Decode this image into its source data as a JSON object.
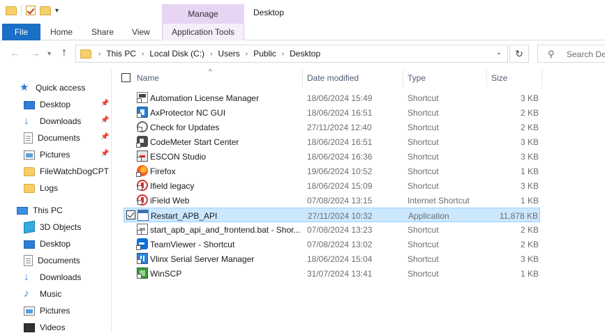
{
  "titlebar": {
    "manage_label": "Manage",
    "window_title": "Desktop"
  },
  "ribbon": {
    "file": "File",
    "home": "Home",
    "share": "Share",
    "view": "View",
    "application_tools": "Application Tools"
  },
  "address": {
    "crumbs": [
      "This PC",
      "Local Disk (C:)",
      "Users",
      "Public",
      "Desktop"
    ],
    "search_placeholder": "Search Des"
  },
  "sidebar": {
    "quick_access": {
      "label": "Quick access",
      "items": [
        {
          "label": "Desktop",
          "icon": "desktop-icon",
          "pinned": true
        },
        {
          "label": "Downloads",
          "icon": "download-icon",
          "pinned": true
        },
        {
          "label": "Documents",
          "icon": "document-icon",
          "pinned": true
        },
        {
          "label": "Pictures",
          "icon": "pictures-icon",
          "pinned": true
        },
        {
          "label": "FileWatchDogCPT",
          "icon": "folder-icon",
          "pinned": false
        },
        {
          "label": "Logs",
          "icon": "folder-icon",
          "pinned": false
        }
      ]
    },
    "this_pc": {
      "label": "This PC",
      "items": [
        {
          "label": "3D Objects",
          "icon": "3d-objects-icon"
        },
        {
          "label": "Desktop",
          "icon": "desktop-icon"
        },
        {
          "label": "Documents",
          "icon": "document-icon"
        },
        {
          "label": "Downloads",
          "icon": "download-icon"
        },
        {
          "label": "Music",
          "icon": "music-icon"
        },
        {
          "label": "Pictures",
          "icon": "pictures-icon"
        },
        {
          "label": "Videos",
          "icon": "videos-icon"
        }
      ]
    }
  },
  "columns": {
    "name": "Name",
    "date": "Date modified",
    "type": "Type",
    "size": "Size"
  },
  "files": [
    {
      "name": "Automation License Manager",
      "date": "18/06/2024 15:49",
      "type": "Shortcut",
      "size": "3 KB",
      "icon": "license-manager-icon"
    },
    {
      "name": "AxProtector NC GUI",
      "date": "18/06/2024 16:51",
      "type": "Shortcut",
      "size": "2 KB",
      "icon": "axprotector-icon"
    },
    {
      "name": "Check for Updates",
      "date": "27/11/2024 12:40",
      "type": "Shortcut",
      "size": "2 KB",
      "icon": "update-icon"
    },
    {
      "name": "CodeMeter Start Center",
      "date": "18/06/2024 16:51",
      "type": "Shortcut",
      "size": "3 KB",
      "icon": "codemeter-icon"
    },
    {
      "name": "ESCON Studio",
      "date": "18/06/2024 16:36",
      "type": "Shortcut",
      "size": "3 KB",
      "icon": "escon-icon"
    },
    {
      "name": "Firefox",
      "date": "19/06/2024 10:52",
      "type": "Shortcut",
      "size": "1 KB",
      "icon": "firefox-icon"
    },
    {
      "name": "Ifield legacy",
      "date": "18/06/2024 15:09",
      "type": "Shortcut",
      "size": "3 KB",
      "icon": "ifield-icon"
    },
    {
      "name": "iField Web",
      "date": "07/08/2024 13:15",
      "type": "Internet Shortcut",
      "size": "1 KB",
      "icon": "ifield-icon"
    },
    {
      "name": "Restart_APB_API",
      "date": "27/11/2024 10:32",
      "type": "Application",
      "size": "11,878 KB",
      "icon": "application-icon",
      "selected": true
    },
    {
      "name": "start_apb_api_and_frontend.bat - Shor...",
      "date": "07/08/2024 13:23",
      "type": "Shortcut",
      "size": "2 KB",
      "icon": "batch-file-icon"
    },
    {
      "name": "TeamViewer - Shortcut",
      "date": "07/08/2024 13:02",
      "type": "Shortcut",
      "size": "2 KB",
      "icon": "teamviewer-icon"
    },
    {
      "name": "Vlinx Serial Server Manager",
      "date": "18/06/2024 15:04",
      "type": "Shortcut",
      "size": "3 KB",
      "icon": "vlinx-icon"
    },
    {
      "name": "WinSCP",
      "date": "31/07/2024 13:41",
      "type": "Shortcut",
      "size": "1 KB",
      "icon": "winscp-icon"
    }
  ],
  "colors": {
    "file_tab": "#1a6fc7",
    "manage_context": "#e8d4f3",
    "selection": "#cce8ff",
    "selection_border": "#99d1ff"
  }
}
